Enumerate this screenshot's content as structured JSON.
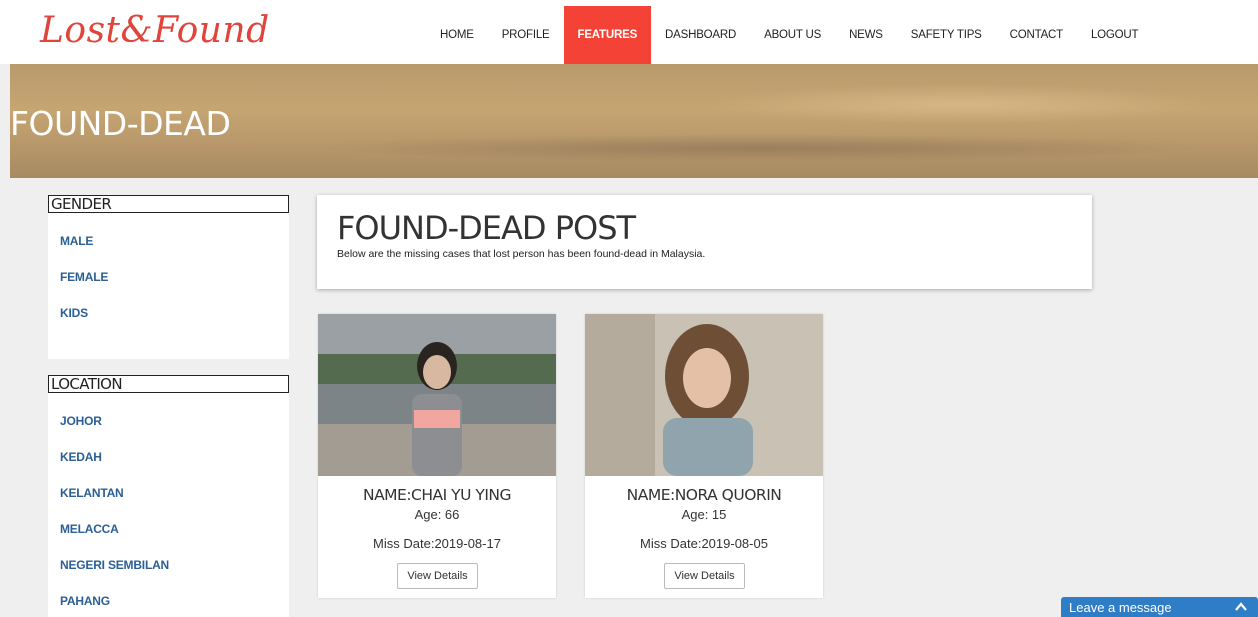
{
  "header": {
    "logo": "Lost&Found",
    "nav": [
      {
        "label": "HOME",
        "active": false
      },
      {
        "label": "PROFILE",
        "active": false
      },
      {
        "label": "FEATURES",
        "active": true
      },
      {
        "label": "DASHBOARD",
        "active": false
      },
      {
        "label": "ABOUT US",
        "active": false
      },
      {
        "label": "NEWS",
        "active": false
      },
      {
        "label": "SAFETY TIPS",
        "active": false
      },
      {
        "label": "CONTACT",
        "active": false
      },
      {
        "label": "LOGOUT",
        "active": false
      }
    ]
  },
  "banner": {
    "title": "FOUND-DEAD"
  },
  "sidebar": {
    "gender": {
      "title": "GENDER",
      "items": [
        "MALE",
        "FEMALE",
        "KIDS"
      ]
    },
    "location": {
      "title": "LOCATION",
      "items": [
        "JOHOR",
        "KEDAH",
        "KELANTAN",
        "MELACCA",
        "NEGERI SEMBILAN",
        "PAHANG"
      ]
    }
  },
  "post": {
    "title": "FOUND-DEAD POST",
    "subtitle": "Below are the missing cases that lost person has been found-dead in Malaysia."
  },
  "cards": [
    {
      "name": "NAME:CHAI YU YING",
      "age": "Age: 66",
      "miss_date": "Miss Date:2019-08-17",
      "button": "View Details"
    },
    {
      "name": "NAME:NORA QUORIN",
      "age": "Age: 15",
      "miss_date": "Miss Date:2019-08-05",
      "button": "View Details"
    }
  ],
  "chat": {
    "label": "Leave a message",
    "icon": "chevron-up-icon"
  },
  "colors": {
    "accent": "#f44336",
    "logo": "#e0453b",
    "link": "#2b5f95",
    "chat": "#2f7cc7"
  }
}
